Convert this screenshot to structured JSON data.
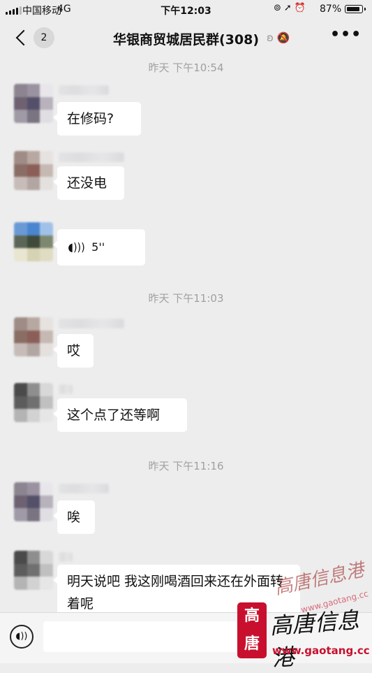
{
  "status_bar": {
    "carrier": "中国移动",
    "network": "4G",
    "time": "下午12:03",
    "battery_percent": "87%",
    "icons": [
      "lock-rotation-icon",
      "location-arrow-icon",
      "alarm-icon"
    ]
  },
  "nav": {
    "unread_count": "2",
    "title": "华银商贸城居民群(308)",
    "title_icons": [
      "ear-icon",
      "mute-bell-icon"
    ],
    "more": "•••"
  },
  "messages": [
    {
      "type": "time",
      "text": "昨天 下午10:54"
    },
    {
      "type": "text",
      "text": "在修码?"
    },
    {
      "type": "text",
      "text": "还没电"
    },
    {
      "type": "voice",
      "duration": "5''"
    },
    {
      "type": "time",
      "text": "昨天 下午11:03"
    },
    {
      "type": "text",
      "text": "哎"
    },
    {
      "type": "text",
      "text": "这个点了还等啊"
    },
    {
      "type": "time",
      "text": "昨天 下午11:16"
    },
    {
      "type": "text",
      "text": "唉"
    },
    {
      "type": "text",
      "text": "明天说吧 我这刚喝酒回来还在外面转着呢"
    }
  ],
  "watermark": {
    "logo_text": "高唐",
    "script_text": "高唐信息港",
    "url": "www.gaotang.cc",
    "brand_color": "#c8102e"
  },
  "colors": {
    "background": "#ededed",
    "bubble": "#ffffff",
    "timestamp": "#a0a0a0"
  }
}
